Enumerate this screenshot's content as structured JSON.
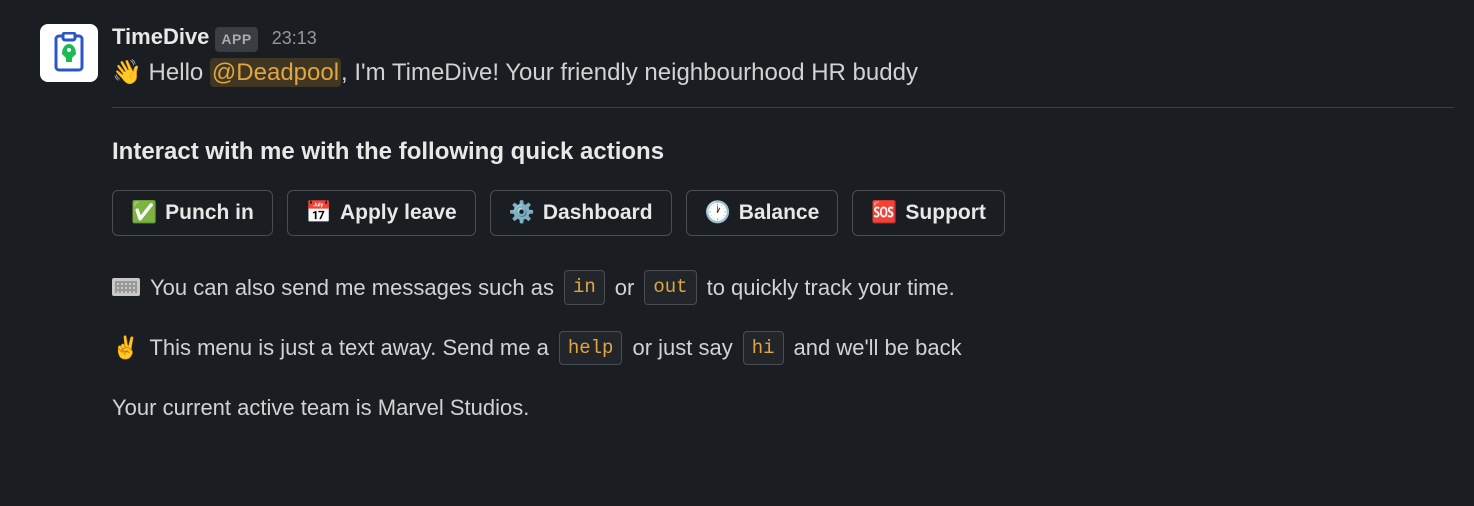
{
  "sender": {
    "name": "TimeDive",
    "badge": "APP",
    "timestamp": "23:13"
  },
  "greeting": {
    "wave_emoji": "👋",
    "pre": " Hello ",
    "mention": "@Deadpool",
    "post": ", I'm TimeDive! Your friendly neighbourhood HR buddy"
  },
  "section_title": "Interact with me with the following quick actions",
  "actions": [
    {
      "emoji": "✅",
      "label": "Punch in"
    },
    {
      "emoji": "📅",
      "label": "Apply leave"
    },
    {
      "emoji": "⚙️",
      "label": "Dashboard"
    },
    {
      "emoji": "🕐",
      "label": "Balance"
    },
    {
      "emoji": "🆘",
      "label": "Support"
    }
  ],
  "info1": {
    "pre": "You can also send me messages such as",
    "code1": "in",
    "mid": "or",
    "code2": "out",
    "post": "to quickly track your time."
  },
  "info2": {
    "emoji": "✌️",
    "pre": "This menu is just a text away. Send me a",
    "code1": "help",
    "mid": "or just say",
    "code2": "hi",
    "post": "and we'll be back"
  },
  "team_line": "Your current active team is Marvel Studios."
}
